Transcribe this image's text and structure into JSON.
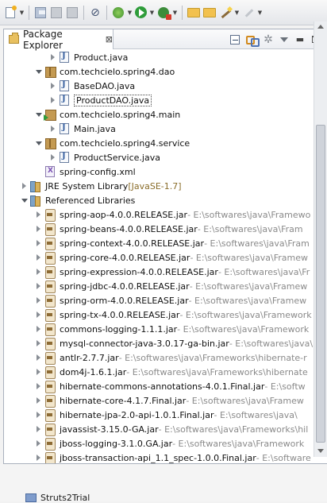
{
  "toolbar": {
    "icons": [
      "new-icon",
      "save-icon",
      "save-all-icon",
      "print-icon",
      "skip-breakpoints-icon",
      "debug-icon",
      "run-icon",
      "external-tools-icon",
      "open-type-icon",
      "open-resource-icon",
      "wand-icon",
      "pencil-icon"
    ]
  },
  "view": {
    "tab_label": "Package Explorer",
    "tab_close": "⊠"
  },
  "tree": [
    {
      "indent": 3,
      "twisty": "closed",
      "icon": "java",
      "label": "Product.java",
      "suffix": ""
    },
    {
      "indent": 2,
      "twisty": "open",
      "icon": "package",
      "label": "com.techcielo.spring4.dao",
      "suffix": ""
    },
    {
      "indent": 3,
      "twisty": "closed",
      "icon": "java",
      "label": "BaseDAO.java",
      "suffix": ""
    },
    {
      "indent": 3,
      "twisty": "closed",
      "icon": "java",
      "label": "ProductDAO.java",
      "suffix": "",
      "selected": true
    },
    {
      "indent": 2,
      "twisty": "open",
      "icon": "package-run",
      "label": "com.techcielo.spring4.main",
      "suffix": ""
    },
    {
      "indent": 3,
      "twisty": "closed",
      "icon": "java",
      "label": "Main.java",
      "suffix": ""
    },
    {
      "indent": 2,
      "twisty": "open",
      "icon": "package",
      "label": "com.techcielo.spring4.service",
      "suffix": ""
    },
    {
      "indent": 3,
      "twisty": "closed",
      "icon": "java",
      "label": "ProductService.java",
      "suffix": ""
    },
    {
      "indent": 2,
      "twisty": "none",
      "icon": "xml",
      "label": "spring-config.xml",
      "suffix": ""
    },
    {
      "indent": 1,
      "twisty": "closed",
      "icon": "lib",
      "label": "JRE System Library",
      "suffix": " [JavaSE-1.7]",
      "jre": true
    },
    {
      "indent": 1,
      "twisty": "open",
      "icon": "lib",
      "label": "Referenced Libraries",
      "suffix": ""
    },
    {
      "indent": 2,
      "twisty": "closed",
      "icon": "jar",
      "label": "spring-aop-4.0.0.RELEASE.jar",
      "suffix": " - E:\\softwares\\java\\Framewo"
    },
    {
      "indent": 2,
      "twisty": "closed",
      "icon": "jar",
      "label": "spring-beans-4.0.0.RELEASE.jar",
      "suffix": " - E:\\softwares\\java\\Fram"
    },
    {
      "indent": 2,
      "twisty": "closed",
      "icon": "jar",
      "label": "spring-context-4.0.0.RELEASE.jar",
      "suffix": " - E:\\softwares\\java\\Fram"
    },
    {
      "indent": 2,
      "twisty": "closed",
      "icon": "jar",
      "label": "spring-core-4.0.0.RELEASE.jar",
      "suffix": " - E:\\softwares\\java\\Framew"
    },
    {
      "indent": 2,
      "twisty": "closed",
      "icon": "jar",
      "label": "spring-expression-4.0.0.RELEASE.jar",
      "suffix": " - E:\\softwares\\java\\Fr"
    },
    {
      "indent": 2,
      "twisty": "closed",
      "icon": "jar",
      "label": "spring-jdbc-4.0.0.RELEASE.jar",
      "suffix": " - E:\\softwares\\java\\Framew"
    },
    {
      "indent": 2,
      "twisty": "closed",
      "icon": "jar",
      "label": "spring-orm-4.0.0.RELEASE.jar",
      "suffix": " - E:\\softwares\\java\\Framew"
    },
    {
      "indent": 2,
      "twisty": "closed",
      "icon": "jar",
      "label": "spring-tx-4.0.0.RELEASE.jar",
      "suffix": " - E:\\softwares\\java\\Framework"
    },
    {
      "indent": 2,
      "twisty": "closed",
      "icon": "jar",
      "label": "commons-logging-1.1.1.jar",
      "suffix": " - E:\\softwares\\java\\Framework"
    },
    {
      "indent": 2,
      "twisty": "closed",
      "icon": "jar",
      "label": "mysql-connector-java-3.0.17-ga-bin.jar",
      "suffix": " - E:\\softwares\\java\\"
    },
    {
      "indent": 2,
      "twisty": "closed",
      "icon": "jar",
      "label": "antlr-2.7.7.jar",
      "suffix": " - E:\\softwares\\java\\Frameworks\\hibernate-r"
    },
    {
      "indent": 2,
      "twisty": "closed",
      "icon": "jar",
      "label": "dom4j-1.6.1.jar",
      "suffix": " - E:\\softwares\\java\\Frameworks\\hibernate"
    },
    {
      "indent": 2,
      "twisty": "closed",
      "icon": "jar",
      "label": "hibernate-commons-annotations-4.0.1.Final.jar",
      "suffix": " - E:\\softw"
    },
    {
      "indent": 2,
      "twisty": "closed",
      "icon": "jar",
      "label": "hibernate-core-4.1.7.Final.jar",
      "suffix": " - E:\\softwares\\java\\Framew"
    },
    {
      "indent": 2,
      "twisty": "closed",
      "icon": "jar",
      "label": "hibernate-jpa-2.0-api-1.0.1.Final.jar",
      "suffix": " - E:\\softwares\\java\\"
    },
    {
      "indent": 2,
      "twisty": "closed",
      "icon": "jar",
      "label": "javassist-3.15.0-GA.jar",
      "suffix": " - E:\\softwares\\java\\Frameworks\\hil"
    },
    {
      "indent": 2,
      "twisty": "closed",
      "icon": "jar",
      "label": "jboss-logging-3.1.0.GA.jar",
      "suffix": " - E:\\softwares\\java\\Framework"
    },
    {
      "indent": 2,
      "twisty": "closed",
      "icon": "jar",
      "label": "jboss-transaction-api_1.1_spec-1.0.0.Final.jar",
      "suffix": " - E:\\software"
    }
  ],
  "bottom": {
    "project_label": "Struts2Trial"
  },
  "colors": {
    "toolbar_bg": "#e4e6ea",
    "tree_bg": "#ffffff",
    "suffix_text": "#8a8a8a",
    "jre_suffix_text": "#8a6d2a"
  }
}
